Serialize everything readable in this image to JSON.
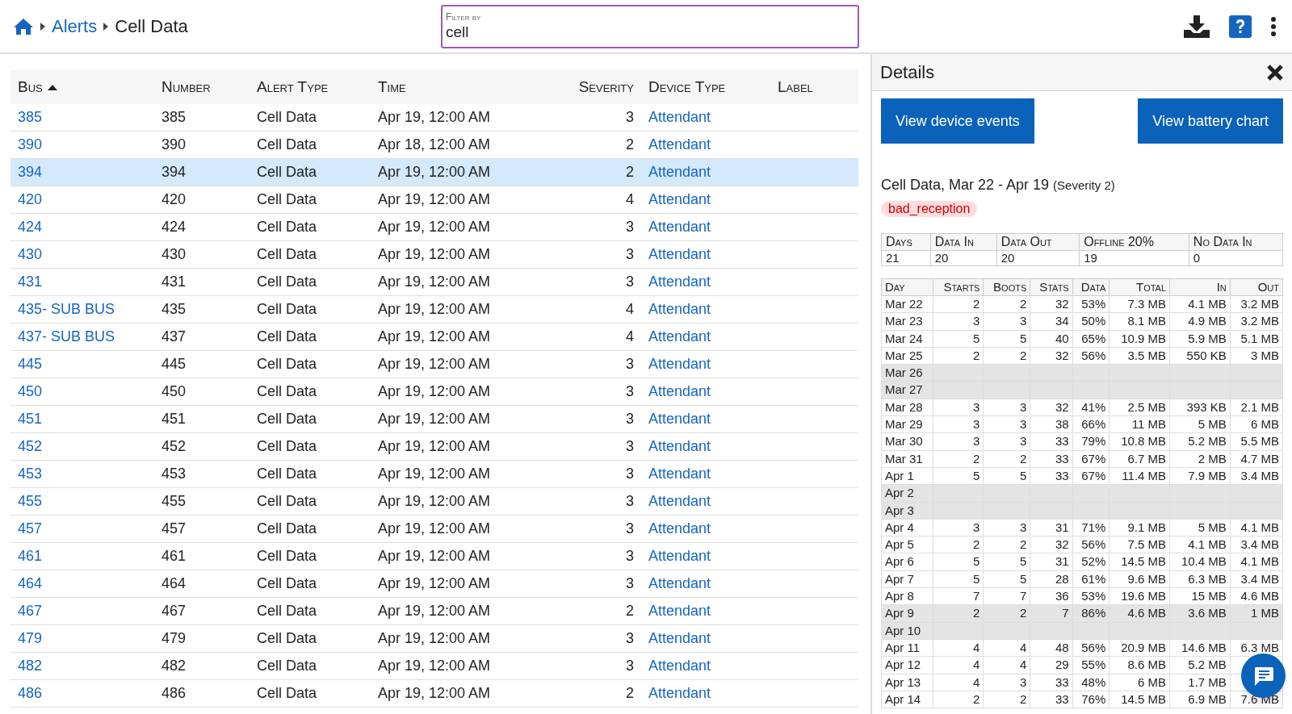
{
  "breadcrumb": [
    {
      "label": "Alerts",
      "link": true
    },
    {
      "label": "Cell Data",
      "link": false
    }
  ],
  "filter": {
    "label": "Filter by",
    "value": "cell"
  },
  "table": {
    "columns": [
      {
        "label": "Bus",
        "sorted": true
      },
      {
        "label": "Number",
        "sorted": false
      },
      {
        "label": "Alert Type",
        "sorted": false
      },
      {
        "label": "Time",
        "sorted": false
      },
      {
        "label": "Severity",
        "sorted": false
      },
      {
        "label": "Device Type",
        "sorted": false
      },
      {
        "label": "Label",
        "sorted": false
      }
    ],
    "rows": [
      {
        "bus": "385",
        "number": "385",
        "alert_type": "Cell Data",
        "time": "Apr 19, 12:00 AM",
        "severity": "3",
        "device_type": "Attendant",
        "selected": false
      },
      {
        "bus": "390",
        "number": "390",
        "alert_type": "Cell Data",
        "time": "Apr 18, 12:00 AM",
        "severity": "2",
        "device_type": "Attendant",
        "selected": false
      },
      {
        "bus": "394",
        "number": "394",
        "alert_type": "Cell Data",
        "time": "Apr 19, 12:00 AM",
        "severity": "2",
        "device_type": "Attendant",
        "selected": true
      },
      {
        "bus": "420",
        "number": "420",
        "alert_type": "Cell Data",
        "time": "Apr 19, 12:00 AM",
        "severity": "4",
        "device_type": "Attendant",
        "selected": false
      },
      {
        "bus": "424",
        "number": "424",
        "alert_type": "Cell Data",
        "time": "Apr 19, 12:00 AM",
        "severity": "3",
        "device_type": "Attendant",
        "selected": false
      },
      {
        "bus": "430",
        "number": "430",
        "alert_type": "Cell Data",
        "time": "Apr 19, 12:00 AM",
        "severity": "3",
        "device_type": "Attendant",
        "selected": false
      },
      {
        "bus": "431",
        "number": "431",
        "alert_type": "Cell Data",
        "time": "Apr 19, 12:00 AM",
        "severity": "3",
        "device_type": "Attendant",
        "selected": false
      },
      {
        "bus": "435- SUB BUS",
        "number": "435",
        "alert_type": "Cell Data",
        "time": "Apr 19, 12:00 AM",
        "severity": "4",
        "device_type": "Attendant",
        "selected": false
      },
      {
        "bus": "437- SUB BUS",
        "number": "437",
        "alert_type": "Cell Data",
        "time": "Apr 19, 12:00 AM",
        "severity": "4",
        "device_type": "Attendant",
        "selected": false
      },
      {
        "bus": "445",
        "number": "445",
        "alert_type": "Cell Data",
        "time": "Apr 19, 12:00 AM",
        "severity": "3",
        "device_type": "Attendant",
        "selected": false
      },
      {
        "bus": "450",
        "number": "450",
        "alert_type": "Cell Data",
        "time": "Apr 19, 12:00 AM",
        "severity": "3",
        "device_type": "Attendant",
        "selected": false
      },
      {
        "bus": "451",
        "number": "451",
        "alert_type": "Cell Data",
        "time": "Apr 19, 12:00 AM",
        "severity": "3",
        "device_type": "Attendant",
        "selected": false
      },
      {
        "bus": "452",
        "number": "452",
        "alert_type": "Cell Data",
        "time": "Apr 19, 12:00 AM",
        "severity": "3",
        "device_type": "Attendant",
        "selected": false
      },
      {
        "bus": "453",
        "number": "453",
        "alert_type": "Cell Data",
        "time": "Apr 19, 12:00 AM",
        "severity": "3",
        "device_type": "Attendant",
        "selected": false
      },
      {
        "bus": "455",
        "number": "455",
        "alert_type": "Cell Data",
        "time": "Apr 19, 12:00 AM",
        "severity": "3",
        "device_type": "Attendant",
        "selected": false
      },
      {
        "bus": "457",
        "number": "457",
        "alert_type": "Cell Data",
        "time": "Apr 19, 12:00 AM",
        "severity": "3",
        "device_type": "Attendant",
        "selected": false
      },
      {
        "bus": "461",
        "number": "461",
        "alert_type": "Cell Data",
        "time": "Apr 19, 12:00 AM",
        "severity": "3",
        "device_type": "Attendant",
        "selected": false
      },
      {
        "bus": "464",
        "number": "464",
        "alert_type": "Cell Data",
        "time": "Apr 19, 12:00 AM",
        "severity": "3",
        "device_type": "Attendant",
        "selected": false
      },
      {
        "bus": "467",
        "number": "467",
        "alert_type": "Cell Data",
        "time": "Apr 19, 12:00 AM",
        "severity": "2",
        "device_type": "Attendant",
        "selected": false
      },
      {
        "bus": "479",
        "number": "479",
        "alert_type": "Cell Data",
        "time": "Apr 19, 12:00 AM",
        "severity": "3",
        "device_type": "Attendant",
        "selected": false
      },
      {
        "bus": "482",
        "number": "482",
        "alert_type": "Cell Data",
        "time": "Apr 19, 12:00 AM",
        "severity": "3",
        "device_type": "Attendant",
        "selected": false
      },
      {
        "bus": "486",
        "number": "486",
        "alert_type": "Cell Data",
        "time": "Apr 19, 12:00 AM",
        "severity": "2",
        "device_type": "Attendant",
        "selected": false
      }
    ]
  },
  "details": {
    "title": "Details",
    "buttons": [
      "View device events",
      "View battery chart"
    ],
    "summary": "Cell Data, Mar 22 - Apr 19",
    "summary_note": "(Severity 2)",
    "tag": "bad_reception",
    "totals": {
      "columns": [
        "Days",
        "Data In",
        "Data Out",
        "Offline 20%",
        "No Data In"
      ],
      "values": [
        "21",
        "20",
        "20",
        "19",
        "0"
      ]
    },
    "daily": {
      "columns": [
        "Day",
        "Starts",
        "Boots",
        "Stats",
        "Data",
        "Total",
        "In",
        "Out"
      ],
      "rows": [
        {
          "cells": [
            "Mar 22",
            "2",
            "2",
            "32",
            "53%",
            "7.3 MB",
            "4.1 MB",
            "3.2 MB"
          ],
          "shaded": false
        },
        {
          "cells": [
            "Mar 23",
            "3",
            "3",
            "34",
            "50%",
            "8.1 MB",
            "4.9 MB",
            "3.2 MB"
          ],
          "shaded": false
        },
        {
          "cells": [
            "Mar 24",
            "5",
            "5",
            "40",
            "65%",
            "10.9 MB",
            "5.9 MB",
            "5.1 MB"
          ],
          "shaded": false
        },
        {
          "cells": [
            "Mar 25",
            "2",
            "2",
            "32",
            "56%",
            "3.5 MB",
            "550 KB",
            "3 MB"
          ],
          "shaded": false
        },
        {
          "cells": [
            "Mar 26"
          ],
          "shaded": true
        },
        {
          "cells": [
            "Mar 27"
          ],
          "shaded": true
        },
        {
          "cells": [
            "Mar 28",
            "3",
            "3",
            "32",
            "41%",
            "2.5 MB",
            "393 KB",
            "2.1 MB"
          ],
          "shaded": false
        },
        {
          "cells": [
            "Mar 29",
            "3",
            "3",
            "38",
            "66%",
            "11 MB",
            "5 MB",
            "6 MB"
          ],
          "shaded": false
        },
        {
          "cells": [
            "Mar 30",
            "3",
            "3",
            "33",
            "79%",
            "10.8 MB",
            "5.2 MB",
            "5.5 MB"
          ],
          "shaded": false
        },
        {
          "cells": [
            "Mar 31",
            "2",
            "2",
            "33",
            "67%",
            "6.7 MB",
            "2 MB",
            "4.7 MB"
          ],
          "shaded": false
        },
        {
          "cells": [
            "Apr 1",
            "5",
            "5",
            "33",
            "67%",
            "11.4 MB",
            "7.9 MB",
            "3.4 MB"
          ],
          "shaded": false
        },
        {
          "cells": [
            "Apr 2"
          ],
          "shaded": true
        },
        {
          "cells": [
            "Apr 3"
          ],
          "shaded": true
        },
        {
          "cells": [
            "Apr 4",
            "3",
            "3",
            "31",
            "71%",
            "9.1 MB",
            "5 MB",
            "4.1 MB"
          ],
          "shaded": false
        },
        {
          "cells": [
            "Apr 5",
            "2",
            "2",
            "32",
            "56%",
            "7.5 MB",
            "4.1 MB",
            "3.4 MB"
          ],
          "shaded": false
        },
        {
          "cells": [
            "Apr 6",
            "5",
            "5",
            "31",
            "52%",
            "14.5 MB",
            "10.4 MB",
            "4.1 MB"
          ],
          "shaded": false
        },
        {
          "cells": [
            "Apr 7",
            "5",
            "5",
            "28",
            "61%",
            "9.6 MB",
            "6.3 MB",
            "3.4 MB"
          ],
          "shaded": false
        },
        {
          "cells": [
            "Apr 8",
            "7",
            "7",
            "36",
            "53%",
            "19.6 MB",
            "15 MB",
            "4.6 MB"
          ],
          "shaded": false
        },
        {
          "cells": [
            "Apr 9",
            "2",
            "2",
            "7",
            "86%",
            "4.6 MB",
            "3.6 MB",
            "1 MB"
          ],
          "shaded": true
        },
        {
          "cells": [
            "Apr 10"
          ],
          "shaded": true
        },
        {
          "cells": [
            "Apr 11",
            "4",
            "4",
            "48",
            "56%",
            "20.9 MB",
            "14.6 MB",
            "6.3 MB"
          ],
          "shaded": false
        },
        {
          "cells": [
            "Apr 12",
            "4",
            "4",
            "29",
            "55%",
            "8.6 MB",
            "5.2 MB"
          ],
          "shaded": false
        },
        {
          "cells": [
            "Apr 13",
            "4",
            "3",
            "33",
            "48%",
            "6 MB",
            "1.7 MB"
          ],
          "shaded": false
        },
        {
          "cells": [
            "Apr 14",
            "2",
            "2",
            "33",
            "76%",
            "14.5 MB",
            "6.9 MB",
            "7.6 MB"
          ],
          "shaded": false
        }
      ]
    }
  }
}
